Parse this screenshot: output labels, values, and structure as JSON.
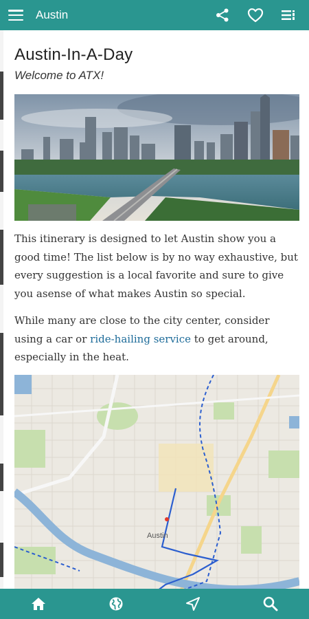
{
  "header": {
    "title": "Austin",
    "menu_icon": "hamburger-menu-icon",
    "actions": [
      "share-icon",
      "heart-icon",
      "list-icon"
    ]
  },
  "article": {
    "title": "Austin-In-A-Day",
    "subtitle": "Welcome to ATX!",
    "hero_image": "austin-skyline-photo",
    "paragraph1": "This itinerary is designed to let Austin show you a good time! The list below is by no way exhaustive, but every suggestion is a local favorite and sure to give you asense of what makes Austin so special.",
    "paragraph2_before": "While many are close to the city center, consider using a car or ",
    "paragraph2_link": "ride-hailing service",
    "paragraph2_after": " to get around, especially in the heat.",
    "map": {
      "image": "austin-route-map",
      "city_label": "Austin"
    }
  },
  "bottom_nav": [
    "home-icon",
    "globe-icon",
    "navigate-icon",
    "search-icon"
  ],
  "colors": {
    "primary": "#2a9690",
    "link": "#1d6b99"
  }
}
